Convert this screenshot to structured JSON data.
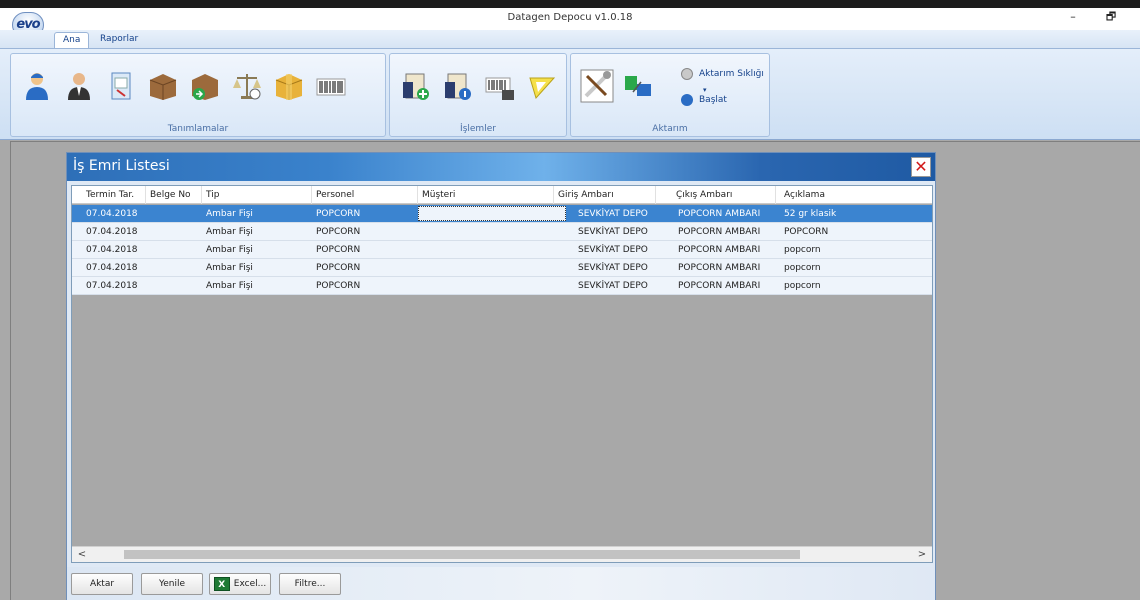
{
  "window": {
    "title": "Datagen Depocu v1.0.18",
    "logo_text": "evo",
    "minimize": "–",
    "restore": "🗗"
  },
  "ribbon": {
    "tabs": [
      {
        "label": "Ana"
      },
      {
        "label": "Raporlar"
      }
    ],
    "groups": {
      "tanimlamalar": "Tanımlamalar",
      "islemler": "İşlemler",
      "aktarim": "Aktarım"
    },
    "aktarim_sikligi": "Aktarım Sıklığı",
    "baslat": "Başlat"
  },
  "list_window": {
    "title": "İş Emri Listesi",
    "close": "✕",
    "columns": [
      "Termin Tar.",
      "Belge No",
      "Tip",
      "Personel",
      "Müşteri",
      "Giriş Ambarı",
      "Çıkış Ambarı",
      "Açıklama"
    ],
    "rows": [
      [
        "07.04.2018",
        "",
        "Ambar Fişi",
        "POPCORN",
        "",
        "SEVKİYAT DEPO",
        "POPCORN AMBARI",
        "52 gr klasik"
      ],
      [
        "07.04.2018",
        "",
        "Ambar Fişi",
        "POPCORN",
        "",
        "SEVKİYAT DEPO",
        "POPCORN AMBARI",
        "POPCORN"
      ],
      [
        "07.04.2018",
        "",
        "Ambar Fişi",
        "POPCORN",
        "",
        "SEVKİYAT DEPO",
        "POPCORN AMBARI",
        "popcorn"
      ],
      [
        "07.04.2018",
        "",
        "Ambar Fişi",
        "POPCORN",
        "",
        "SEVKİYAT DEPO",
        "POPCORN AMBARI",
        "popcorn"
      ],
      [
        "07.04.2018",
        "",
        "Ambar Fişi",
        "POPCORN",
        "",
        "SEVKİYAT DEPO",
        "POPCORN AMBARI",
        "popcorn"
      ]
    ],
    "scroll_left": "<",
    "scroll_right": ">",
    "buttons": {
      "aktar": "Aktar",
      "yenile": "Yenile",
      "excel": "Excel...",
      "excel_icon": "X",
      "filtre": "Filtre..."
    }
  },
  "colors": {
    "selection": "#3b84d0",
    "accent": "#2e6fb8"
  }
}
